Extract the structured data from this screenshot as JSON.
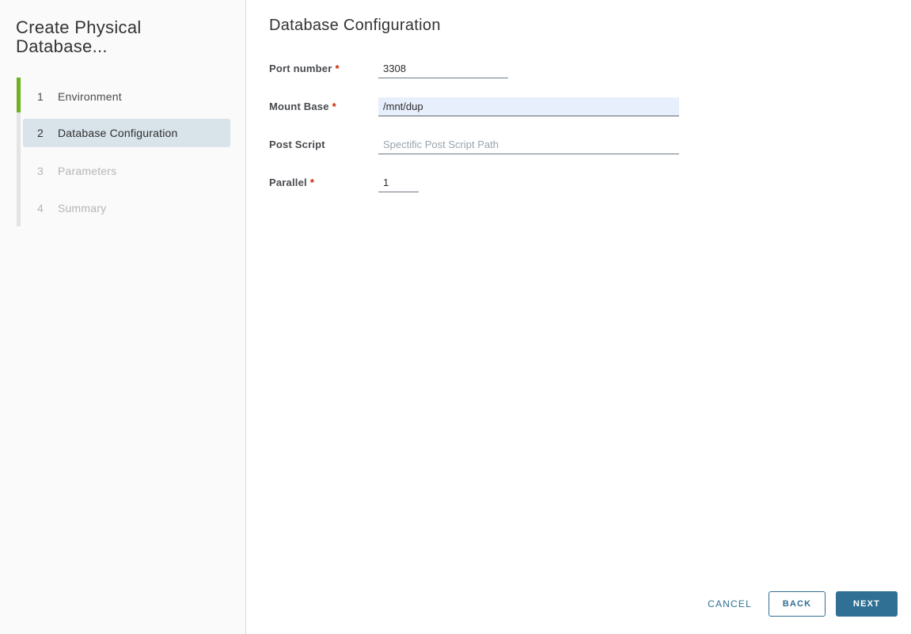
{
  "sidebar": {
    "title": "Create Physical Database...",
    "steps": [
      {
        "number": "1",
        "label": "Environment",
        "state": "completed"
      },
      {
        "number": "2",
        "label": "Database Configuration",
        "state": "current"
      },
      {
        "number": "3",
        "label": "Parameters",
        "state": "disabled"
      },
      {
        "number": "4",
        "label": "Summary",
        "state": "disabled"
      }
    ]
  },
  "main": {
    "title": "Database Configuration",
    "required_marker": "*",
    "fields": [
      {
        "label": "Port number",
        "required": true,
        "value": "3308",
        "placeholder": ""
      },
      {
        "label": "Mount Base",
        "required": true,
        "value": "/mnt/dup",
        "placeholder": "",
        "highlighted": true
      },
      {
        "label": "Post Script",
        "required": false,
        "value": "",
        "placeholder": "Spectific Post Script Path"
      },
      {
        "label": "Parallel",
        "required": true,
        "value": "1",
        "placeholder": ""
      }
    ]
  },
  "footer": {
    "cancel_label": "CANCEL",
    "back_label": "BACK",
    "next_label": "NEXT"
  },
  "colors": {
    "accent_blue": "#2f7094",
    "step_done_green": "#6db21d",
    "current_step_bg": "#d9e4ea",
    "highlight_input_bg": "#e8effc",
    "required_red": "#c92100",
    "sidebar_bg": "#fafafa"
  }
}
